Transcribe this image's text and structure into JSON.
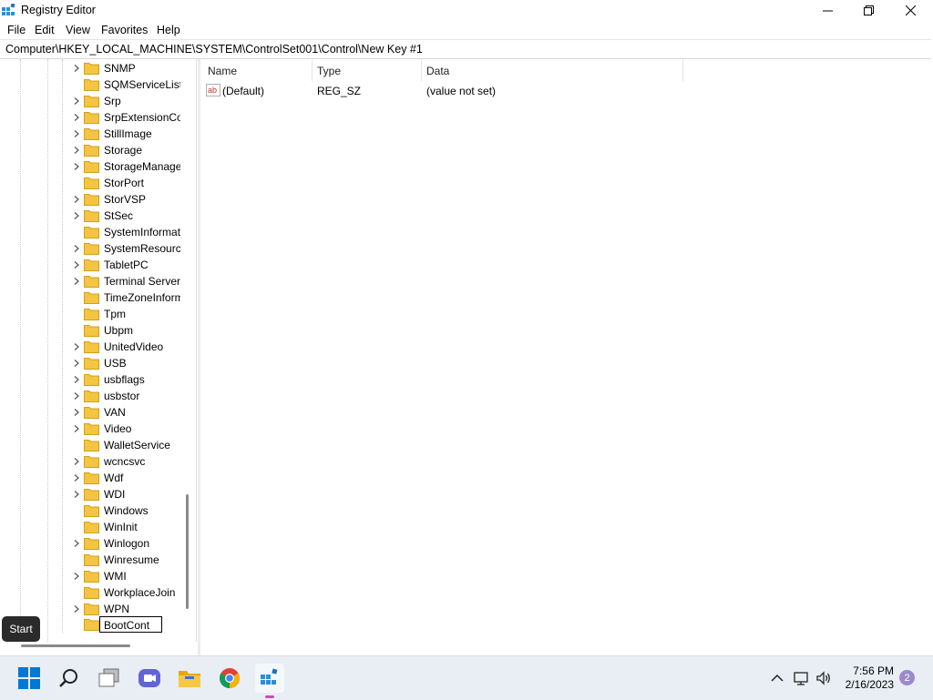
{
  "window": {
    "title": "Registry Editor",
    "minimize_glyph": "—",
    "restore_glyph": "❐",
    "close_glyph": "✕"
  },
  "menu": [
    "File",
    "Edit",
    "View",
    "Favorites",
    "Help"
  ],
  "address": "Computer\\HKEY_LOCAL_MACHINE\\SYSTEM\\ControlSet001\\Control\\New Key #1",
  "tree": {
    "items": [
      {
        "label": "SNMP",
        "expandable": true
      },
      {
        "label": "SQMServiceList",
        "expandable": false
      },
      {
        "label": "Srp",
        "expandable": true
      },
      {
        "label": "SrpExtensionConfig",
        "expandable": true
      },
      {
        "label": "StillImage",
        "expandable": true
      },
      {
        "label": "Storage",
        "expandable": true
      },
      {
        "label": "StorageManagement",
        "expandable": true
      },
      {
        "label": "StorPort",
        "expandable": false
      },
      {
        "label": "StorVSP",
        "expandable": true
      },
      {
        "label": "StSec",
        "expandable": true
      },
      {
        "label": "SystemInformation",
        "expandable": false
      },
      {
        "label": "SystemResources",
        "expandable": true
      },
      {
        "label": "TabletPC",
        "expandable": true
      },
      {
        "label": "Terminal Server",
        "expandable": true
      },
      {
        "label": "TimeZoneInformation",
        "expandable": false
      },
      {
        "label": "Tpm",
        "expandable": false
      },
      {
        "label": "Ubpm",
        "expandable": false
      },
      {
        "label": "UnitedVideo",
        "expandable": true
      },
      {
        "label": "USB",
        "expandable": true
      },
      {
        "label": "usbflags",
        "expandable": true
      },
      {
        "label": "usbstor",
        "expandable": true
      },
      {
        "label": "VAN",
        "expandable": true
      },
      {
        "label": "Video",
        "expandable": true
      },
      {
        "label": "WalletService",
        "expandable": false
      },
      {
        "label": "wcncsvc",
        "expandable": true
      },
      {
        "label": "Wdf",
        "expandable": true
      },
      {
        "label": "WDI",
        "expandable": true
      },
      {
        "label": "Windows",
        "expandable": false
      },
      {
        "label": "WinInit",
        "expandable": false
      },
      {
        "label": "Winlogon",
        "expandable": true
      },
      {
        "label": "Winresume",
        "expandable": false
      },
      {
        "label": "WMI",
        "expandable": true
      },
      {
        "label": "WorkplaceJoin",
        "expandable": false
      },
      {
        "label": "WPN",
        "expandable": true
      }
    ],
    "rename_value": "BootCont"
  },
  "tooltip": "Start",
  "list": {
    "columns": [
      "Name",
      "Type",
      "Data"
    ],
    "rows": [
      {
        "name": "(Default)",
        "type": "REG_SZ",
        "data": "(value not set)",
        "icon": "string-value-icon"
      }
    ]
  },
  "taskbar": {
    "time": "7:56 PM",
    "date": "2/16/2023",
    "notification_count": "2"
  },
  "colors": {
    "folder": "#f4c542",
    "windows_blue": "#0078d4",
    "accent_underline": "#c44dbb"
  }
}
